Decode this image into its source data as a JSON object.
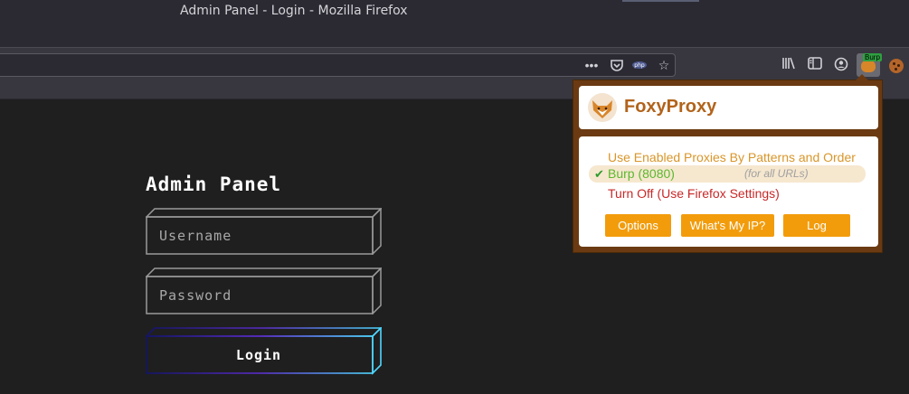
{
  "window": {
    "title": "Admin Panel - Login - Mozilla Firefox"
  },
  "toolbar": {
    "url_icons": [
      "more-dots-icon",
      "pocket-icon",
      "php-icon",
      "bookmark-star-icon"
    ],
    "library_icon": "library-icon",
    "sidebar_icon": "sidebar-icon",
    "account_icon": "account-icon",
    "foxyproxy_badge": "Burp"
  },
  "page": {
    "title": "Admin Panel",
    "username_placeholder": "Username",
    "password_placeholder": "Password",
    "login_label": "Login",
    "accent_gradient": [
      "#1a1a7a",
      "#6a2fd6",
      "#4fd8ff"
    ]
  },
  "foxyproxy": {
    "name": "FoxyProxy",
    "options": {
      "patterns": "Use Enabled Proxies By Patterns and Order",
      "burp": "Burp (8080)",
      "burp_scope": "(for all URLs)",
      "off": "Turn Off (Use Firefox Settings)"
    },
    "selected": "burp",
    "buttons": {
      "options": "Options",
      "whats_my_ip": "What's My IP?",
      "log": "Log"
    },
    "colors": {
      "frame": "#6b3a12",
      "name": "#b2631a",
      "button": "#f29c0c"
    }
  }
}
